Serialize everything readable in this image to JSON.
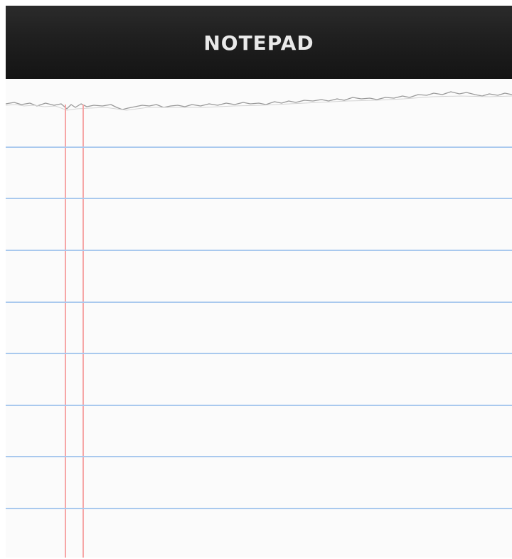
{
  "app": {
    "title": "NOTEPAD"
  },
  "notepad": {
    "text": "",
    "ruled_line_count": 8,
    "margin_line_count": 2,
    "colors": {
      "titlebar": "#1f1f1f",
      "title_text": "#e9e9e9",
      "paper": "#fbfbfb",
      "rule_line": "#a9c9ee",
      "margin_line": "#f6a6a6",
      "torn_edge": "#9a9a9a"
    }
  }
}
